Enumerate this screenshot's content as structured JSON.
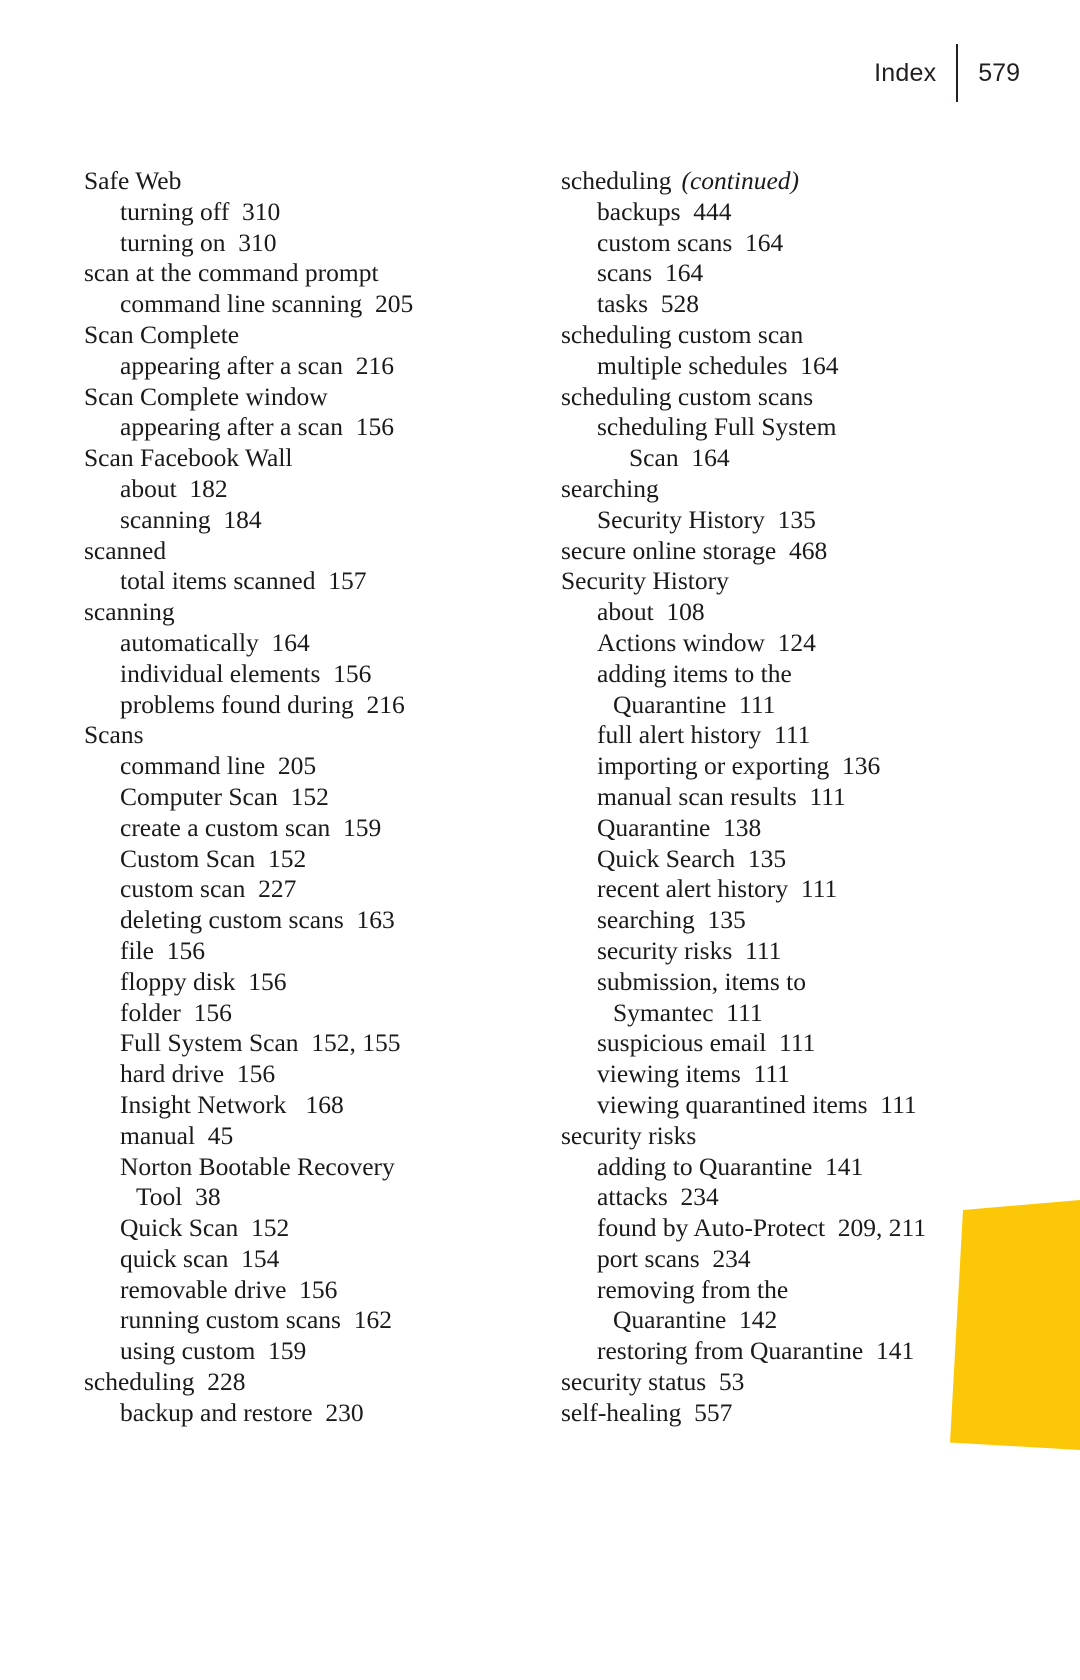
{
  "running_head": {
    "label": "Index",
    "folio": "579"
  },
  "decor": {
    "thumb_tab_color": "#fcc707"
  },
  "columns": [
    {
      "name": "left-column",
      "entries": [
        {
          "level": 0,
          "text": "Safe Web"
        },
        {
          "level": 1,
          "text": "turning off  310"
        },
        {
          "level": 1,
          "text": "turning on  310"
        },
        {
          "level": 0,
          "text": "scan at the command prompt"
        },
        {
          "level": 1,
          "text": "command line scanning  205"
        },
        {
          "level": 0,
          "text": "Scan Complete"
        },
        {
          "level": 1,
          "text": "appearing after a scan  216"
        },
        {
          "level": 0,
          "text": "Scan Complete window"
        },
        {
          "level": 1,
          "text": "appearing after a scan  156"
        },
        {
          "level": 0,
          "text": "Scan Facebook Wall"
        },
        {
          "level": 1,
          "text": "about  182"
        },
        {
          "level": 1,
          "text": "scanning  184"
        },
        {
          "level": 0,
          "text": "scanned"
        },
        {
          "level": 1,
          "text": "total items scanned  157"
        },
        {
          "level": 0,
          "text": "scanning"
        },
        {
          "level": 1,
          "text": "automatically  164"
        },
        {
          "level": 1,
          "text": "individual elements  156"
        },
        {
          "level": 1,
          "text": "problems found during  216"
        },
        {
          "level": 0,
          "text": "Scans"
        },
        {
          "level": 1,
          "text": "command line  205"
        },
        {
          "level": 1,
          "text": "Computer Scan  152"
        },
        {
          "level": 1,
          "text": "create a custom scan  159"
        },
        {
          "level": 1,
          "text": "Custom Scan  152"
        },
        {
          "level": 1,
          "text": "custom scan  227"
        },
        {
          "level": 1,
          "text": "deleting custom scans  163"
        },
        {
          "level": 1,
          "text": "file  156"
        },
        {
          "level": 1,
          "text": "floppy disk  156"
        },
        {
          "level": 1,
          "text": "folder  156"
        },
        {
          "level": 1,
          "text": "Full System Scan  152, 155"
        },
        {
          "level": 1,
          "text": "hard drive  156"
        },
        {
          "level": 1,
          "text": "Insight Network   168"
        },
        {
          "level": 1,
          "text": "manual  45"
        },
        {
          "level": 1,
          "text": "Norton Bootable Recovery"
        },
        {
          "level": "cont1",
          "text": "Tool  38"
        },
        {
          "level": 1,
          "text": "Quick Scan  152"
        },
        {
          "level": 1,
          "text": "quick scan  154"
        },
        {
          "level": 1,
          "text": "removable drive  156"
        },
        {
          "level": 1,
          "text": "running custom scans  162"
        },
        {
          "level": 1,
          "text": "using custom  159"
        },
        {
          "level": 0,
          "text": "scheduling  228"
        },
        {
          "level": 1,
          "text": "backup and restore  230"
        }
      ]
    },
    {
      "name": "right-column",
      "entries": [
        {
          "level": 0,
          "text": "scheduling",
          "continued": "(continued)"
        },
        {
          "level": 1,
          "text": "backups  444"
        },
        {
          "level": 1,
          "text": "custom scans  164"
        },
        {
          "level": 1,
          "text": "scans  164"
        },
        {
          "level": 1,
          "text": "tasks  528"
        },
        {
          "level": 0,
          "text": "scheduling custom scan"
        },
        {
          "level": 1,
          "text": "multiple schedules  164"
        },
        {
          "level": 0,
          "text": "scheduling custom scans"
        },
        {
          "level": 1,
          "text": "scheduling Full System"
        },
        {
          "level": "cont2",
          "text": "Scan  164"
        },
        {
          "level": 0,
          "text": "searching"
        },
        {
          "level": 1,
          "text": "Security History  135"
        },
        {
          "level": 0,
          "text": "secure online storage  468"
        },
        {
          "level": 0,
          "text": "Security History"
        },
        {
          "level": 1,
          "text": "about  108"
        },
        {
          "level": 1,
          "text": "Actions window  124"
        },
        {
          "level": 1,
          "text": "adding items to the"
        },
        {
          "level": "cont1",
          "text": "Quarantine  111"
        },
        {
          "level": 1,
          "text": "full alert history  111"
        },
        {
          "level": 1,
          "text": "importing or exporting  136"
        },
        {
          "level": 1,
          "text": "manual scan results  111"
        },
        {
          "level": 1,
          "text": "Quarantine  138"
        },
        {
          "level": 1,
          "text": "Quick Search  135"
        },
        {
          "level": 1,
          "text": "recent alert history  111"
        },
        {
          "level": 1,
          "text": "searching  135"
        },
        {
          "level": 1,
          "text": "security risks  111"
        },
        {
          "level": 1,
          "text": "submission, items to"
        },
        {
          "level": "cont1",
          "text": "Symantec  111"
        },
        {
          "level": 1,
          "text": "suspicious email  111"
        },
        {
          "level": 1,
          "text": "viewing items  111"
        },
        {
          "level": 1,
          "text": "viewing quarantined items  111"
        },
        {
          "level": 0,
          "text": "security risks"
        },
        {
          "level": 1,
          "text": "adding to Quarantine  141"
        },
        {
          "level": 1,
          "text": "attacks  234"
        },
        {
          "level": 1,
          "text": "found by Auto-Protect  209, 211"
        },
        {
          "level": 1,
          "text": "port scans  234"
        },
        {
          "level": 1,
          "text": "removing from the"
        },
        {
          "level": "cont1",
          "text": "Quarantine  142"
        },
        {
          "level": 1,
          "text": "restoring from Quarantine  141"
        },
        {
          "level": 0,
          "text": "security status  53"
        },
        {
          "level": 0,
          "text": "self-healing  557"
        }
      ]
    }
  ]
}
